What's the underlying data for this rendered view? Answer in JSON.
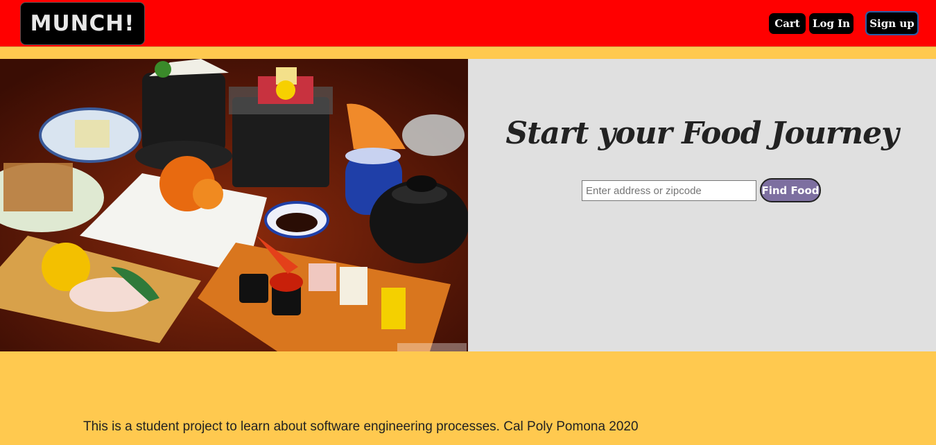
{
  "header": {
    "logo_text": "MUNCH!",
    "cart_label": "Cart",
    "login_label": "Log In",
    "signup_label": "Sign up"
  },
  "hero": {
    "image_icon": "food-platter-image",
    "headline": "Start your Food Journey",
    "search_placeholder": "Enter address or zipcode",
    "find_label": "Find Food"
  },
  "footer": {
    "text": "This is a student project to learn about software engineering processes. Cal Poly Pomona 2020"
  },
  "colors": {
    "navbar": "#ff0000",
    "page_bg": "#ffc94f",
    "panel_bg": "#e0e0e0",
    "find_button": "#7d6fa0"
  }
}
